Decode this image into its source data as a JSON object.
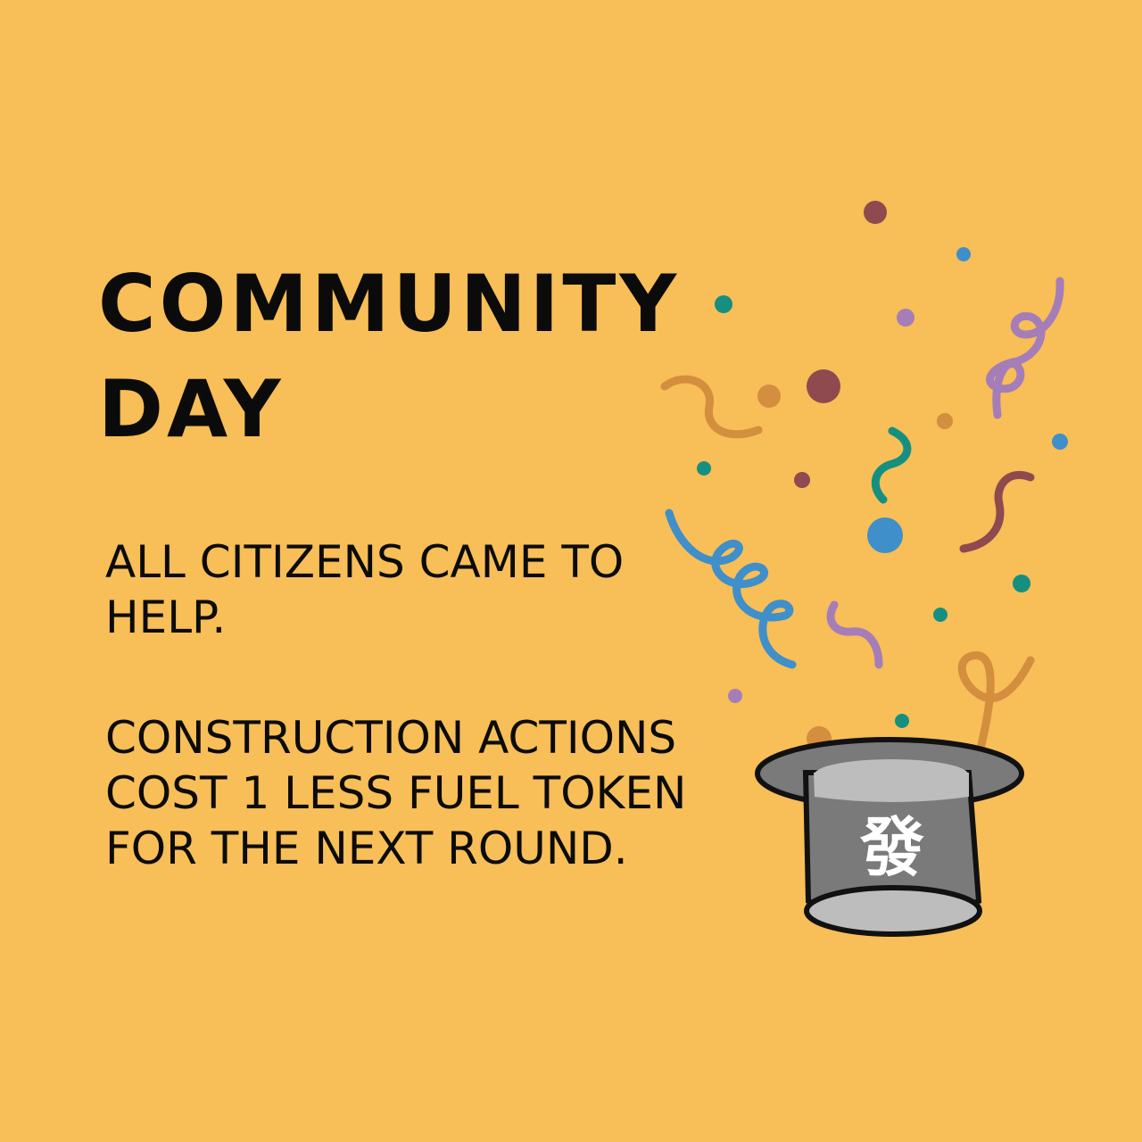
{
  "card": {
    "background": "#F8BE57",
    "title_lines": [
      "COMMUNITY",
      "DAY"
    ],
    "paragraph1_lines": [
      "ALL CITIZENS CAME TO",
      "HELP."
    ],
    "paragraph2_lines": [
      "CONSTRUCTION ACTIONS",
      "COST 1 LESS FUEL TOKEN",
      "FOR THE NEXT ROUND."
    ],
    "hat_glyph": "發",
    "colors": {
      "text": "#0B0B0B",
      "hat_body": "#7A7A7A",
      "hat_band": "#BDBDBD",
      "confetti_brown": "#8E4A4E",
      "confetti_blue": "#3F8FCB",
      "confetti_teal": "#159080",
      "confetti_lilac": "#A57DB8",
      "confetti_orange": "#D38E3E"
    },
    "icons": [
      "confetti-icon",
      "top-hat-icon"
    ]
  }
}
